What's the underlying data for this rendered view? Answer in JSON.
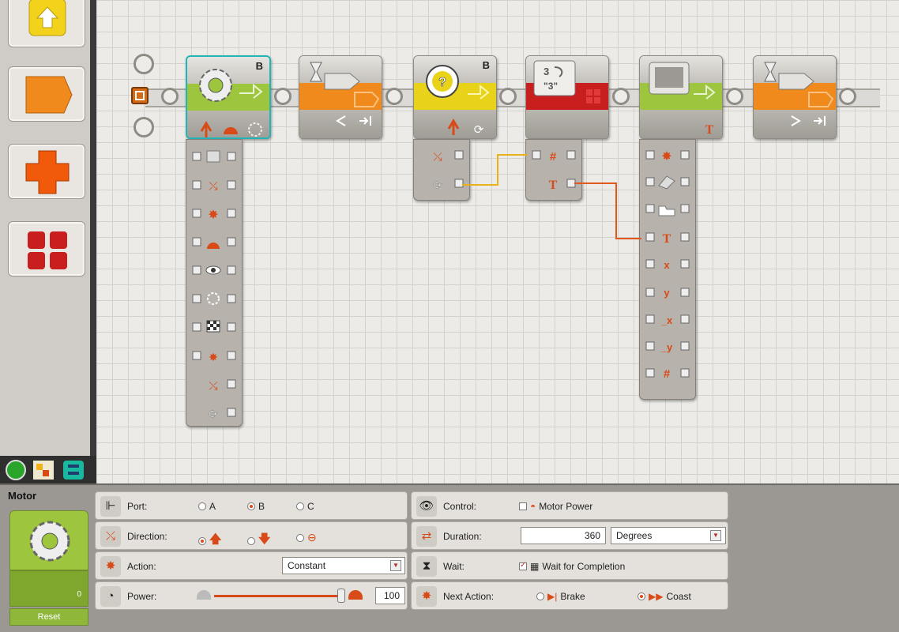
{
  "config": {
    "title": "Motor",
    "counter_value": "0",
    "reset_label": "Reset",
    "port": {
      "label": "Port:",
      "options": [
        "A",
        "B",
        "C"
      ],
      "selected": "B"
    },
    "direction": {
      "label": "Direction:",
      "selected": "forward"
    },
    "action": {
      "label": "Action:",
      "value": "Constant"
    },
    "power": {
      "label": "Power:",
      "value": "100"
    },
    "control": {
      "label": "Control:",
      "option": "Motor Power",
      "checked": false
    },
    "duration": {
      "label": "Duration:",
      "value": "360",
      "unit": "Degrees"
    },
    "wait": {
      "label": "Wait:",
      "option": "Wait for Completion",
      "checked": true
    },
    "next_action": {
      "label": "Next Action:",
      "options": [
        "Brake",
        "Coast"
      ],
      "selected": "Coast"
    }
  },
  "blocks": {
    "motor": {
      "port_letter": "B"
    },
    "compare": {
      "port_letter": "B"
    },
    "number_to_text": {
      "top_number": "3",
      "bottom_text": "\"3\""
    },
    "display": {
      "mode_symbol": "T"
    }
  },
  "colors": {
    "accent": "#d84a17",
    "green": "#9ec53e",
    "orange": "#f08a1c",
    "yellow": "#e8d21a",
    "red": "#c81e1e"
  }
}
